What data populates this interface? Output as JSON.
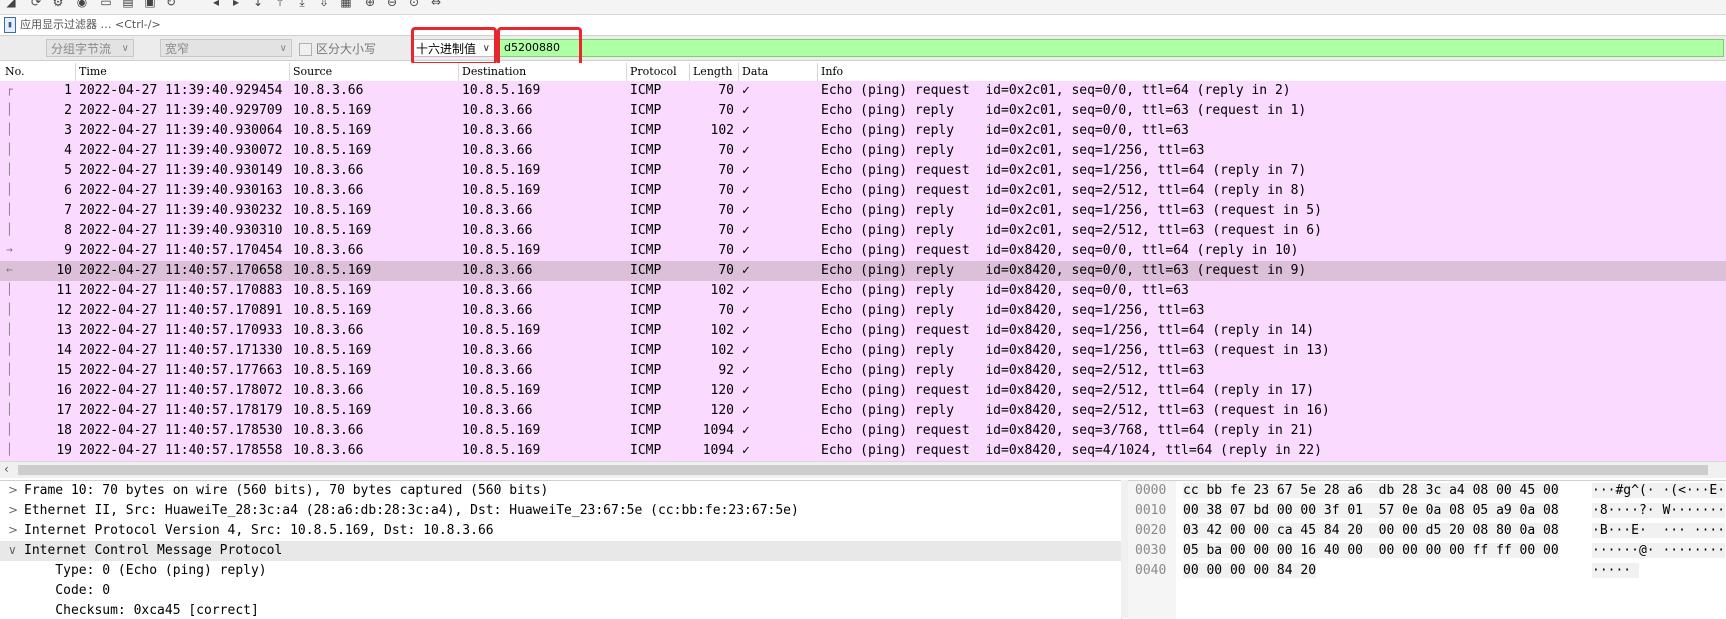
{
  "toolbar": {
    "icons": [
      "shark-fin-stop-icon",
      "restart-icon",
      "options-icon",
      "capture-icon",
      "open-file-icon",
      "save-file-icon",
      "close-file-icon",
      "reload-icon",
      "go-back-icon",
      "go-forward-icon",
      "go-to-icon",
      "first-packet-icon",
      "last-packet-icon",
      "auto-scroll-icon",
      "colorize-icon",
      "zoom-in-icon",
      "zoom-out-icon",
      "zoom-reset-icon",
      "resize-columns-icon"
    ]
  },
  "filter": {
    "placeholder": "应用显示过滤器 … <Ctrl-/>"
  },
  "search": {
    "scope_select": "分组字节流",
    "charset_select": "宽窄",
    "case_label": "区分大小写",
    "type_select": "十六进制值",
    "value": "d5200880"
  },
  "packet_list": {
    "columns": [
      "No.",
      "Time",
      "Source",
      "Destination",
      "Protocol",
      "Length",
      "Data",
      "Info"
    ],
    "selected_index": 9,
    "rows": [
      {
        "no": "1",
        "time": "2022-04-27 11:39:40.929454",
        "src": "10.8.3.66",
        "dst": "10.8.5.169",
        "proto": "ICMP",
        "len": "70",
        "data": "✓",
        "info": "Echo (ping) request  id=0x2c01, seq=0/0, ttl=64 (reply in 2)"
      },
      {
        "no": "2",
        "time": "2022-04-27 11:39:40.929709",
        "src": "10.8.5.169",
        "dst": "10.8.3.66",
        "proto": "ICMP",
        "len": "70",
        "data": "✓",
        "info": "Echo (ping) reply    id=0x2c01, seq=0/0, ttl=63 (request in 1)"
      },
      {
        "no": "3",
        "time": "2022-04-27 11:39:40.930064",
        "src": "10.8.5.169",
        "dst": "10.8.3.66",
        "proto": "ICMP",
        "len": "102",
        "data": "✓",
        "info": "Echo (ping) reply    id=0x2c01, seq=0/0, ttl=63"
      },
      {
        "no": "4",
        "time": "2022-04-27 11:39:40.930072",
        "src": "10.8.5.169",
        "dst": "10.8.3.66",
        "proto": "ICMP",
        "len": "70",
        "data": "✓",
        "info": "Echo (ping) reply    id=0x2c01, seq=1/256, ttl=63"
      },
      {
        "no": "5",
        "time": "2022-04-27 11:39:40.930149",
        "src": "10.8.3.66",
        "dst": "10.8.5.169",
        "proto": "ICMP",
        "len": "70",
        "data": "✓",
        "info": "Echo (ping) request  id=0x2c01, seq=1/256, ttl=64 (reply in 7)"
      },
      {
        "no": "6",
        "time": "2022-04-27 11:39:40.930163",
        "src": "10.8.3.66",
        "dst": "10.8.5.169",
        "proto": "ICMP",
        "len": "70",
        "data": "✓",
        "info": "Echo (ping) request  id=0x2c01, seq=2/512, ttl=64 (reply in 8)"
      },
      {
        "no": "7",
        "time": "2022-04-27 11:39:40.930232",
        "src": "10.8.5.169",
        "dst": "10.8.3.66",
        "proto": "ICMP",
        "len": "70",
        "data": "✓",
        "info": "Echo (ping) reply    id=0x2c01, seq=1/256, ttl=63 (request in 5)"
      },
      {
        "no": "8",
        "time": "2022-04-27 11:39:40.930310",
        "src": "10.8.5.169",
        "dst": "10.8.3.66",
        "proto": "ICMP",
        "len": "70",
        "data": "✓",
        "info": "Echo (ping) reply    id=0x2c01, seq=2/512, ttl=63 (request in 6)"
      },
      {
        "no": "9",
        "time": "2022-04-27 11:40:57.170454",
        "src": "10.8.3.66",
        "dst": "10.8.5.169",
        "proto": "ICMP",
        "len": "70",
        "data": "✓",
        "info": "Echo (ping) request  id=0x8420, seq=0/0, ttl=64 (reply in 10)"
      },
      {
        "no": "10",
        "time": "2022-04-27 11:40:57.170658",
        "src": "10.8.5.169",
        "dst": "10.8.3.66",
        "proto": "ICMP",
        "len": "70",
        "data": "✓",
        "info": "Echo (ping) reply    id=0x8420, seq=0/0, ttl=63 (request in 9)"
      },
      {
        "no": "11",
        "time": "2022-04-27 11:40:57.170883",
        "src": "10.8.5.169",
        "dst": "10.8.3.66",
        "proto": "ICMP",
        "len": "102",
        "data": "✓",
        "info": "Echo (ping) reply    id=0x8420, seq=0/0, ttl=63"
      },
      {
        "no": "12",
        "time": "2022-04-27 11:40:57.170891",
        "src": "10.8.5.169",
        "dst": "10.8.3.66",
        "proto": "ICMP",
        "len": "70",
        "data": "✓",
        "info": "Echo (ping) reply    id=0x8420, seq=1/256, ttl=63"
      },
      {
        "no": "13",
        "time": "2022-04-27 11:40:57.170933",
        "src": "10.8.3.66",
        "dst": "10.8.5.169",
        "proto": "ICMP",
        "len": "102",
        "data": "✓",
        "info": "Echo (ping) request  id=0x8420, seq=1/256, ttl=64 (reply in 14)"
      },
      {
        "no": "14",
        "time": "2022-04-27 11:40:57.171330",
        "src": "10.8.5.169",
        "dst": "10.8.3.66",
        "proto": "ICMP",
        "len": "102",
        "data": "✓",
        "info": "Echo (ping) reply    id=0x8420, seq=1/256, ttl=63 (request in 13)"
      },
      {
        "no": "15",
        "time": "2022-04-27 11:40:57.177663",
        "src": "10.8.5.169",
        "dst": "10.8.3.66",
        "proto": "ICMP",
        "len": "92",
        "data": "✓",
        "info": "Echo (ping) reply    id=0x8420, seq=2/512, ttl=63"
      },
      {
        "no": "16",
        "time": "2022-04-27 11:40:57.178072",
        "src": "10.8.3.66",
        "dst": "10.8.5.169",
        "proto": "ICMP",
        "len": "120",
        "data": "✓",
        "info": "Echo (ping) request  id=0x8420, seq=2/512, ttl=64 (reply in 17)"
      },
      {
        "no": "17",
        "time": "2022-04-27 11:40:57.178179",
        "src": "10.8.5.169",
        "dst": "10.8.3.66",
        "proto": "ICMP",
        "len": "120",
        "data": "✓",
        "info": "Echo (ping) reply    id=0x8420, seq=2/512, ttl=63 (request in 16)"
      },
      {
        "no": "18",
        "time": "2022-04-27 11:40:57.178530",
        "src": "10.8.3.66",
        "dst": "10.8.5.169",
        "proto": "ICMP",
        "len": "1094",
        "data": "✓",
        "info": "Echo (ping) request  id=0x8420, seq=3/768, ttl=64 (reply in 21)"
      },
      {
        "no": "19",
        "time": "2022-04-27 11:40:57.178558",
        "src": "10.8.3.66",
        "dst": "10.8.5.169",
        "proto": "ICMP",
        "len": "1094",
        "data": "✓",
        "info": "Echo (ping) request  id=0x8420, seq=4/1024, ttl=64 (reply in 22)"
      }
    ]
  },
  "details": {
    "rows": [
      {
        "toggle": ">",
        "text": "Frame 10: 70 bytes on wire (560 bits), 70 bytes captured (560 bits)"
      },
      {
        "toggle": ">",
        "text": "Ethernet II, Src: HuaweiTe_28:3c:a4 (28:a6:db:28:3c:a4), Dst: HuaweiTe_23:67:5e (cc:bb:fe:23:67:5e)"
      },
      {
        "toggle": ">",
        "text": "Internet Protocol Version 4, Src: 10.8.5.169, Dst: 10.8.3.66"
      },
      {
        "toggle": "∨",
        "text": "Internet Control Message Protocol"
      },
      {
        "toggle": "",
        "text": "    Type: 0 (Echo (ping) reply)"
      },
      {
        "toggle": "",
        "text": "    Code: 0"
      },
      {
        "toggle": "",
        "text": "    Checksum: 0xca45 [correct]"
      }
    ]
  },
  "bytes": {
    "rows": [
      {
        "off": "0000",
        "hex": "cc bb fe 23 67 5e 28 a6  db 28 3c a4 08 00 45 00",
        "ascii": "···#g^(· ·(<···E·"
      },
      {
        "off": "0010",
        "hex": "00 38 07 bd 00 00 3f 01  57 0e 0a 08 05 a9 0a 08",
        "ascii": "·8····?· W·······"
      },
      {
        "off": "0020",
        "hex": "03 42 00 00 ca 45 84 20  00 00 d5 20 08 80 0a 08",
        "ascii": "·B···E·  ··· ····"
      },
      {
        "off": "0030",
        "hex": "05 ba 00 00 00 16 40 00  00 00 00 00 ff ff 00 00",
        "ascii": "······@· ········"
      },
      {
        "off": "0040",
        "hex": "00 00 00 00 84 20",
        "ascii": "····· "
      }
    ]
  }
}
